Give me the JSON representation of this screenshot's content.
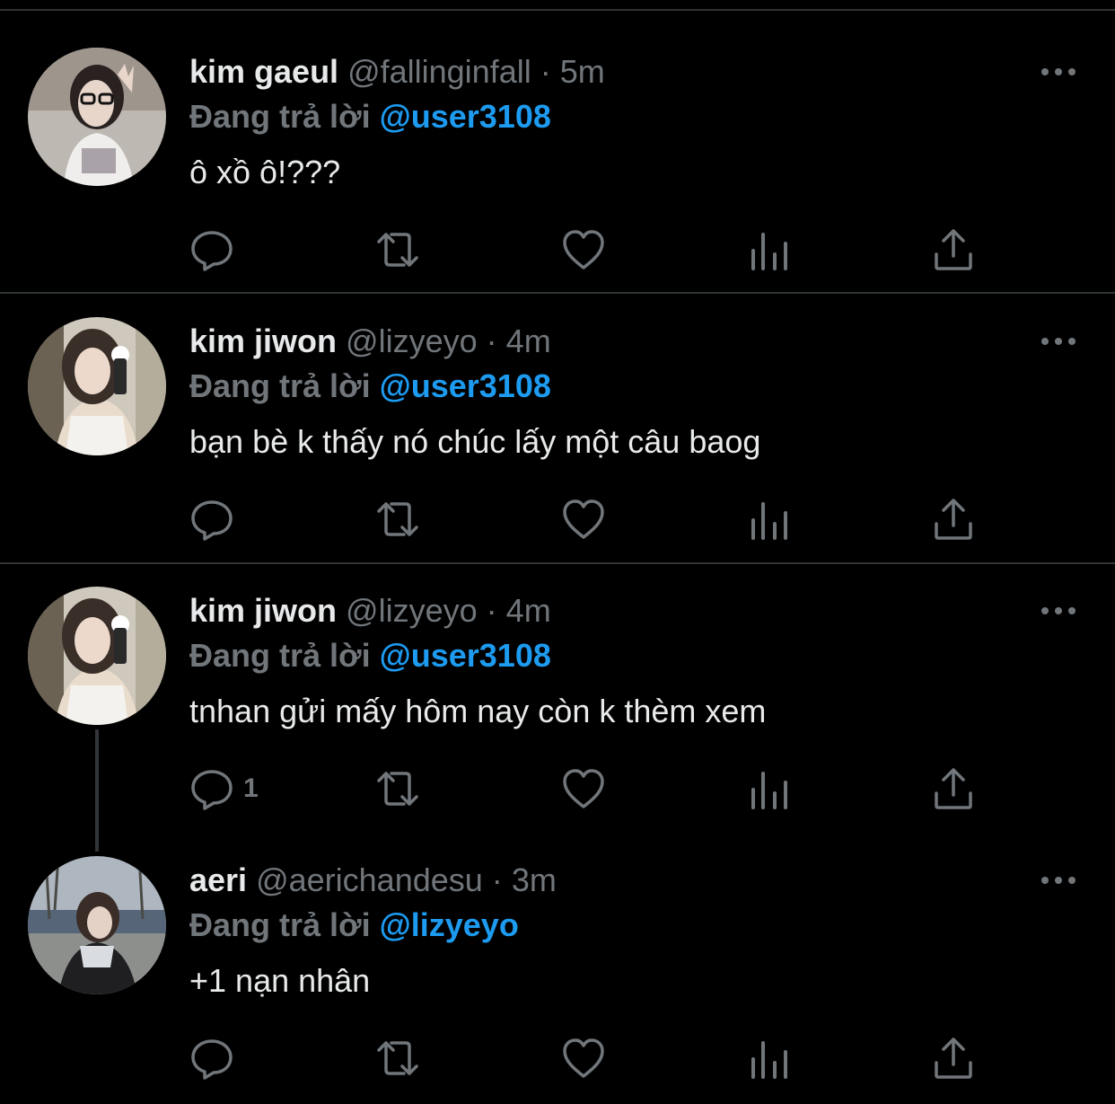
{
  "tweets": [
    {
      "name": "kim gaeul",
      "handle": "@fallinginfall",
      "dot": "·",
      "time": "5m",
      "reply_prefix": "Đang trả lời",
      "reply_to": "@user3108",
      "text": "ô xồ ô!???",
      "reply_count": "",
      "avatar": "avatar-gaeul"
    },
    {
      "name": "kim jiwon",
      "handle": "@lizyeyo",
      "dot": "·",
      "time": "4m",
      "reply_prefix": "Đang trả lời",
      "reply_to": "@user3108",
      "text": "bạn bè k thấy nó chúc lấy một câu baog",
      "reply_count": "",
      "avatar": "avatar-jiwon"
    },
    {
      "name": "kim jiwon",
      "handle": "@lizyeyo",
      "dot": "·",
      "time": "4m",
      "reply_prefix": "Đang trả lời",
      "reply_to": "@user3108",
      "text": "tnhan gửi mấy hôm nay còn k thèm xem",
      "reply_count": "1",
      "avatar": "avatar-jiwon"
    },
    {
      "name": "aeri",
      "handle": "@aerichandesu",
      "dot": "·",
      "time": "3m",
      "reply_prefix": "Đang trả lời",
      "reply_to": "@lizyeyo",
      "text": "+1 nạn nhân",
      "reply_count": "",
      "avatar": "avatar-aeri"
    }
  ],
  "icons": {
    "reply": "reply-icon",
    "retweet": "retweet-icon",
    "like": "heart-icon",
    "views": "views-icon",
    "share": "share-icon",
    "more": "more-icon"
  },
  "colors": {
    "background": "#000000",
    "text": "#e7e9ea",
    "muted": "#71767b",
    "mention": "#1d9bf0",
    "divider": "#2f3336"
  }
}
